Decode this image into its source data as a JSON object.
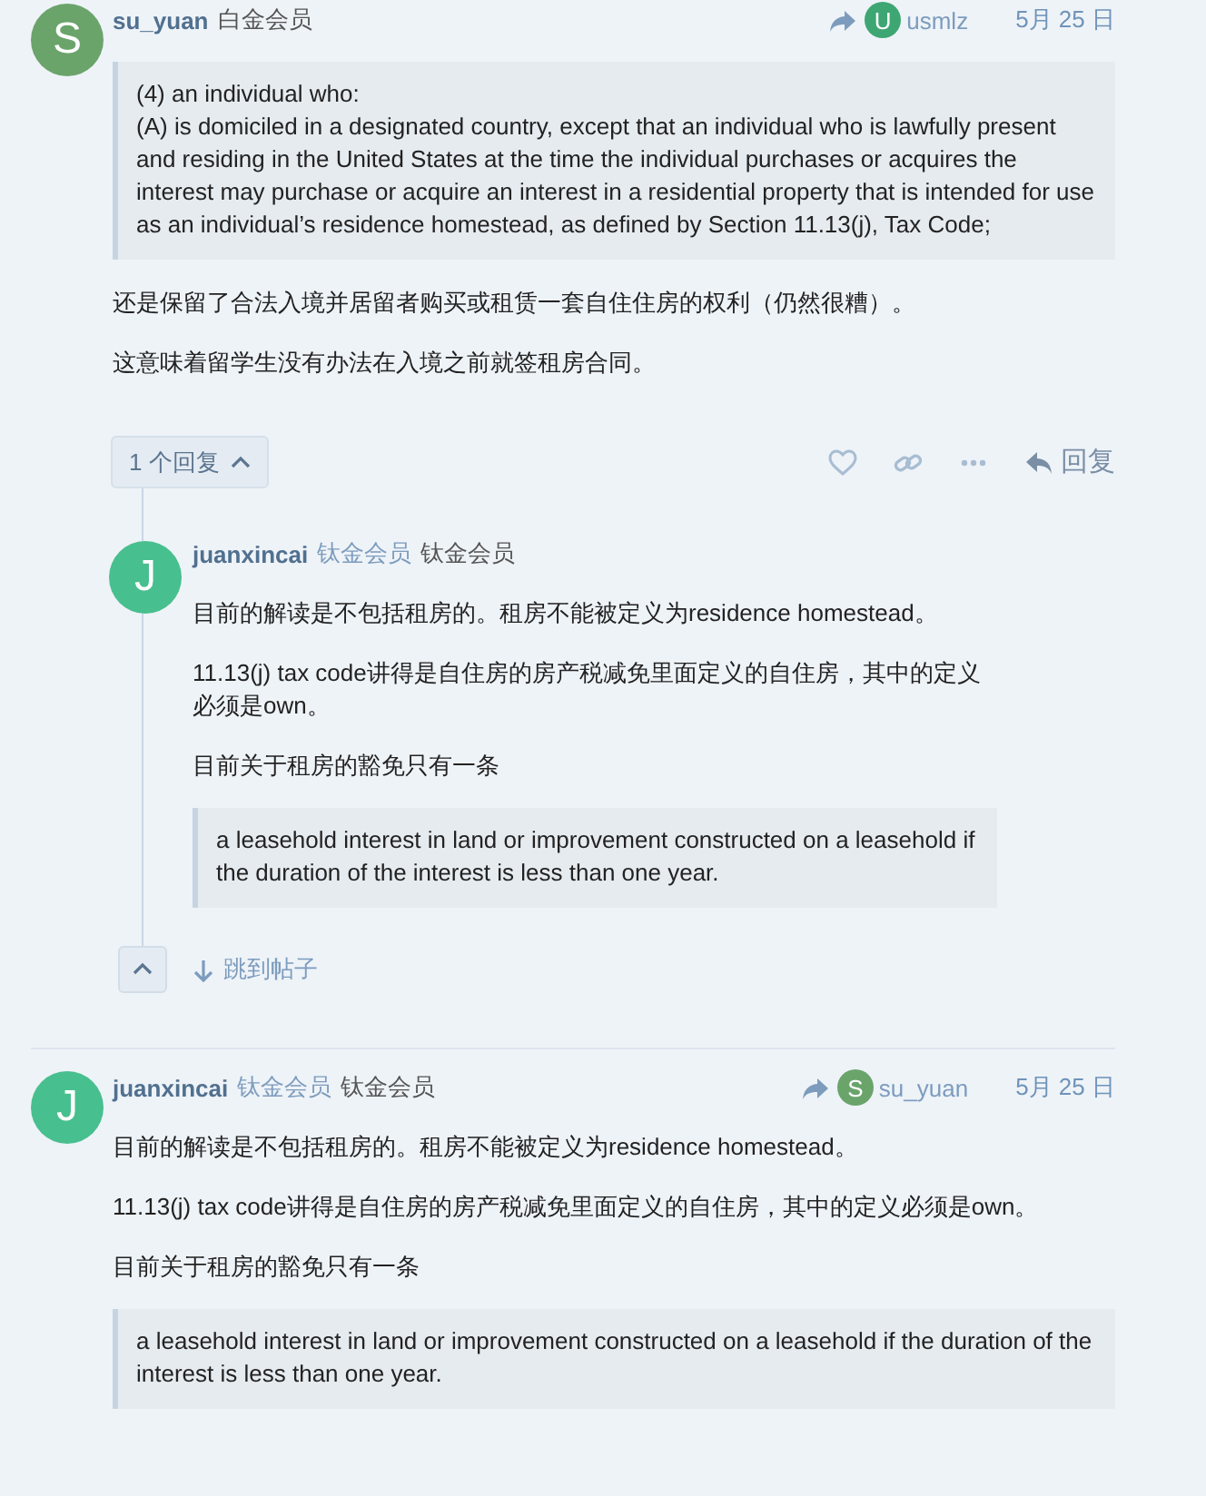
{
  "posts": [
    {
      "author": "su_yuan",
      "avatar": {
        "letter": "S",
        "color": "#6aa46b"
      },
      "titles": [
        {
          "text": "白金会员",
          "kind": "title"
        }
      ],
      "reply_to": {
        "name": "usmlz",
        "avatar": {
          "letter": "U",
          "color": "#3ea672"
        }
      },
      "date": "5月 25 日",
      "body": [
        {
          "kind": "quote",
          "lines": [
            "(4) an individual who:",
            "(A) is domiciled in a designated country, except that an individual who is lawfully present and residing in the United States at the time the individual purchases or acquires the interest may purchase or acquire an interest in a residential property that is intended for use as an individual’s residence homestead, as defined by Section 11.13(j), Tax Code;"
          ]
        },
        {
          "kind": "paragraph",
          "text": "还是保留了合法入境并居留者购买或租赁一套自住住房的权利（仍然很糟）。"
        },
        {
          "kind": "paragraph",
          "text": "这意味着留学生没有办法在入境之前就签租房合同。"
        }
      ],
      "actions": {
        "replies_button": {
          "label": "1 个回复",
          "expanded": true
        },
        "reply_label": "回复"
      },
      "replies": [
        {
          "author": "juanxincai",
          "avatar": {
            "letter": "J",
            "color": "#48bf8e"
          },
          "titles": [
            {
              "text": "钛金会员",
              "kind": "group"
            },
            {
              "text": "钛金会员",
              "kind": "title"
            }
          ],
          "body": [
            {
              "kind": "paragraph",
              "text": "目前的解读是不包括租房的。租房不能被定义为residence homestead。"
            },
            {
              "kind": "paragraph",
              "text": "11.13(j) tax code讲得是自住房的房产税减免里面定义的自住房，其中的定义必须是own。"
            },
            {
              "kind": "paragraph",
              "text": "目前关于租房的豁免只有一条"
            },
            {
              "kind": "quote",
              "lines": [
                "a leasehold interest in land or improvement constructed on a leasehold if the duration of the interest is less than one year."
              ]
            }
          ],
          "jump_label": "跳到帖子"
        }
      ]
    },
    {
      "author": "juanxincai",
      "avatar": {
        "letter": "J",
        "color": "#48bf8e"
      },
      "titles": [
        {
          "text": "钛金会员",
          "kind": "group"
        },
        {
          "text": "钛金会员",
          "kind": "title"
        }
      ],
      "reply_to": {
        "name": "su_yuan",
        "avatar": {
          "letter": "S",
          "color": "#6aa46b"
        }
      },
      "date": "5月 25 日",
      "body": [
        {
          "kind": "paragraph",
          "text": "目前的解读是不包括租房的。租房不能被定义为residence homestead。"
        },
        {
          "kind": "paragraph",
          "text": "11.13(j) tax code讲得是自住房的房产税减免里面定义的自住房，其中的定义必须是own。"
        },
        {
          "kind": "paragraph",
          "text": "目前关于租房的豁免只有一条"
        },
        {
          "kind": "quote",
          "lines": [
            "a leasehold interest in land or improvement constructed on a leasehold if the duration of the interest is less than one year."
          ]
        }
      ]
    }
  ]
}
